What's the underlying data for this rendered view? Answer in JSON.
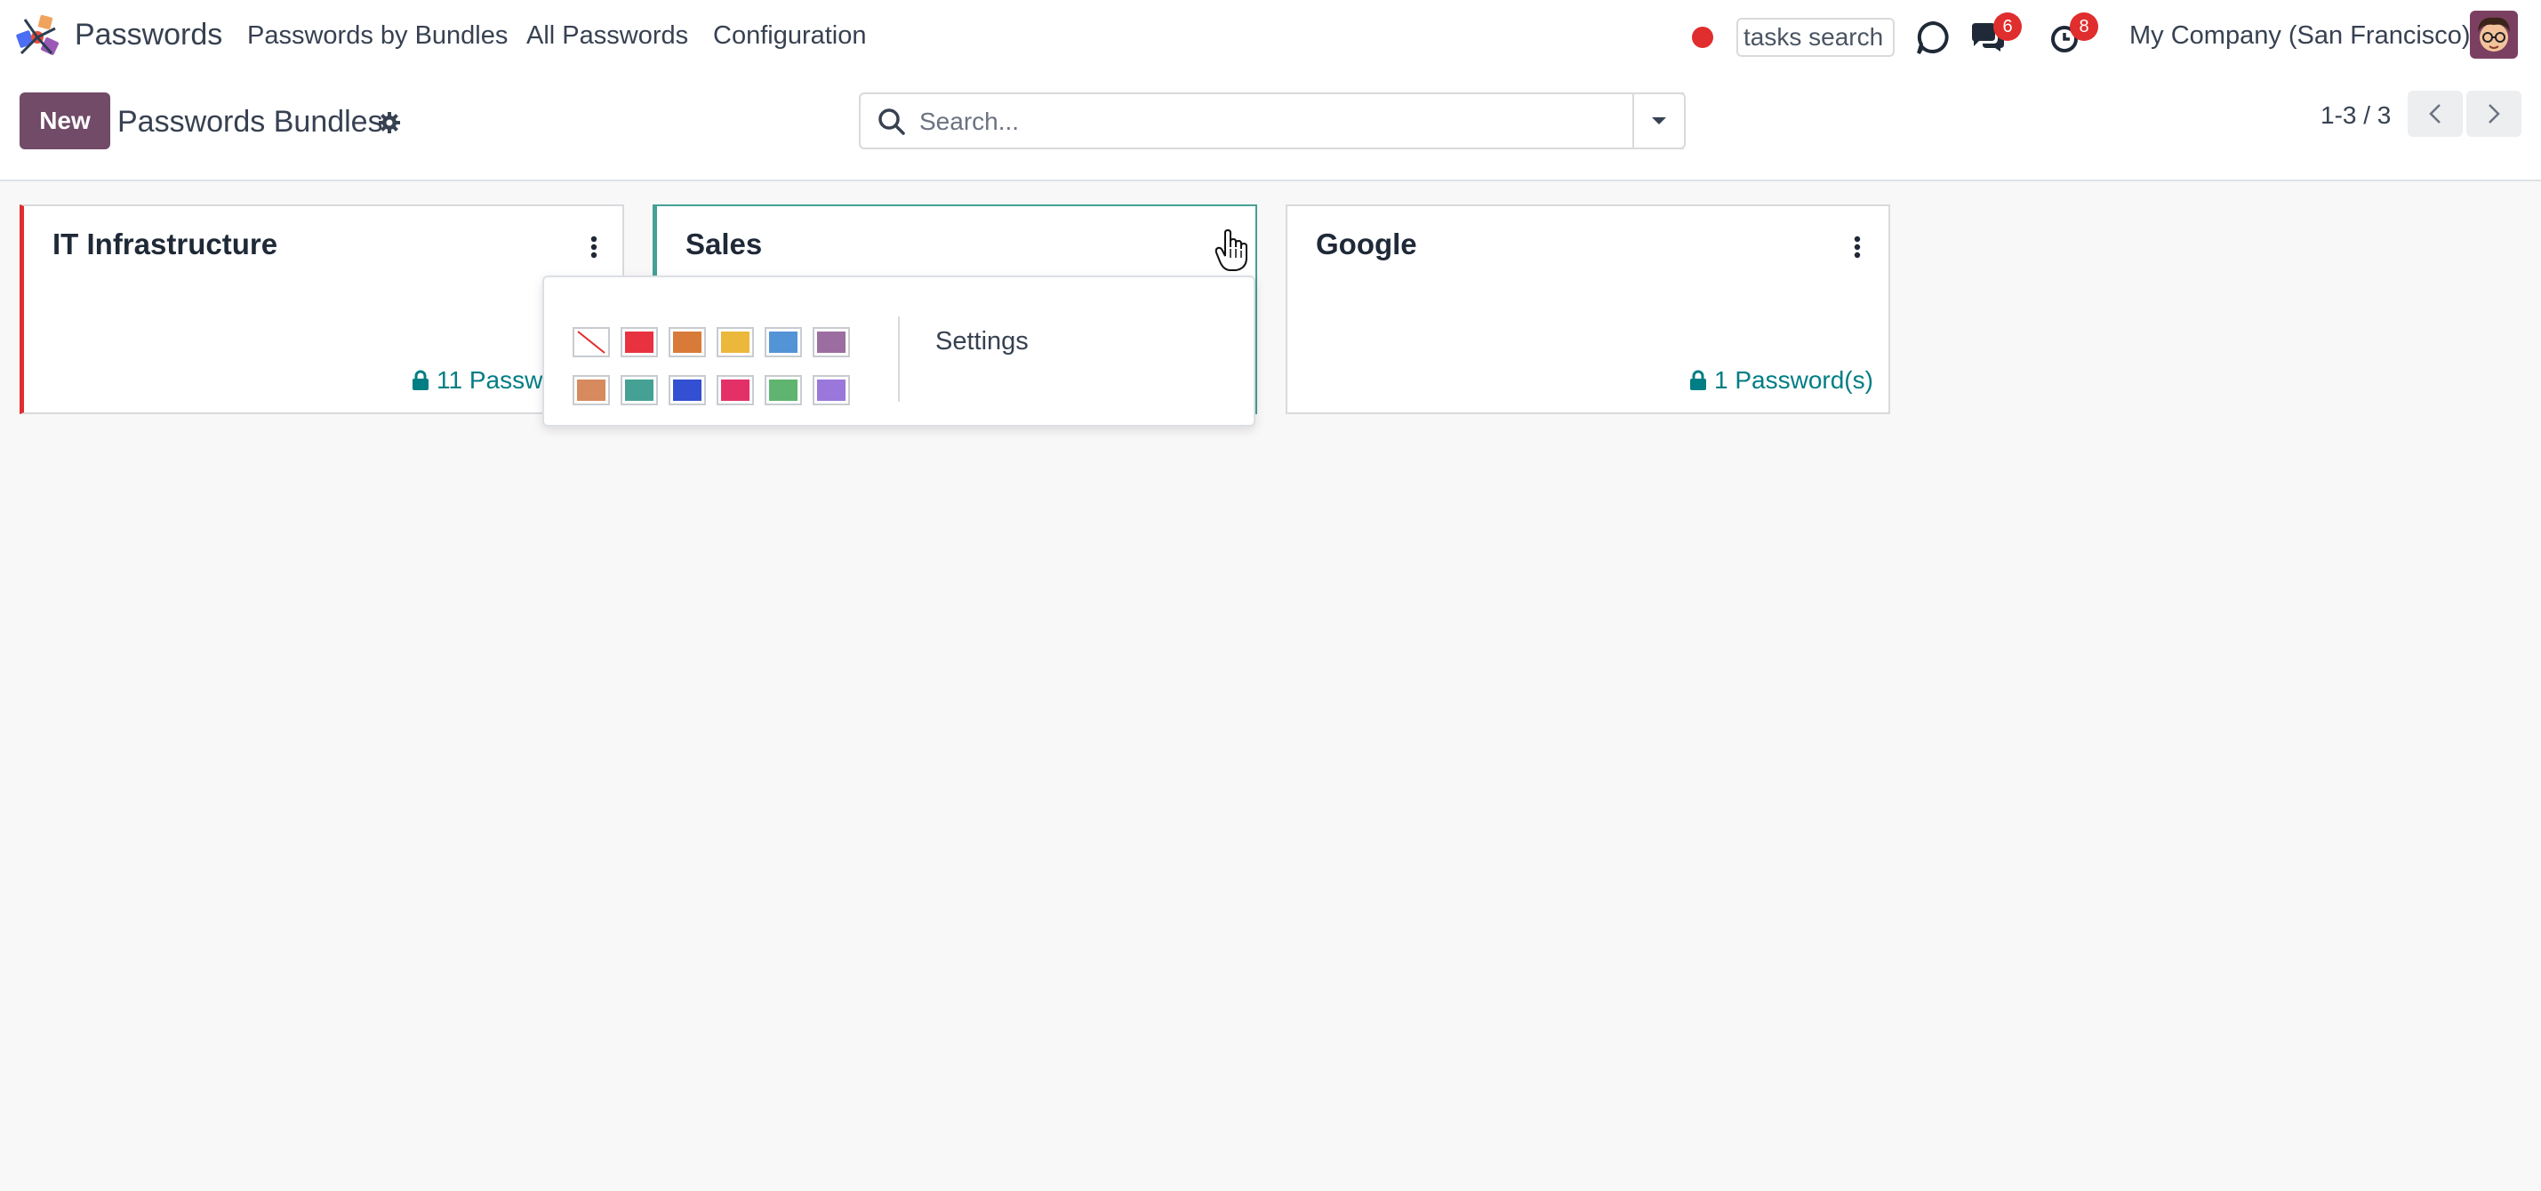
{
  "navbar": {
    "app_name": "Passwords",
    "menu": [
      "Passwords by Bundles",
      "All Passwords",
      "Configuration"
    ],
    "tasks_search_placeholder": "tasks search",
    "messages_badge": "6",
    "activities_badge": "8",
    "company": "My Company (San Francisco)"
  },
  "control_panel": {
    "new_label": "New",
    "title": "Passwords Bundles",
    "search_placeholder": "Search...",
    "pager": "1-3 / 3"
  },
  "cards": [
    {
      "title": "IT Infrastructure",
      "count": "11 Passwo",
      "accent": "#e02d2d"
    },
    {
      "title": "Sales",
      "count": "",
      "accent": "#44a194"
    },
    {
      "title": "Google",
      "count": "1 Password(s)",
      "accent": ""
    }
  ],
  "dropdown": {
    "colors_row1": [
      "none",
      "#e9323f",
      "#d97b38",
      "#ecb83b",
      "#5394d7",
      "#9c6da1"
    ],
    "colors_row2": [
      "#d78a5e",
      "#44a194",
      "#3350d2",
      "#e33168",
      "#5fb46f",
      "#9a77da"
    ],
    "settings_label": "Settings"
  },
  "colors": {
    "brand": "#714b67",
    "link": "#017e84",
    "badge": "#e02d2d"
  }
}
